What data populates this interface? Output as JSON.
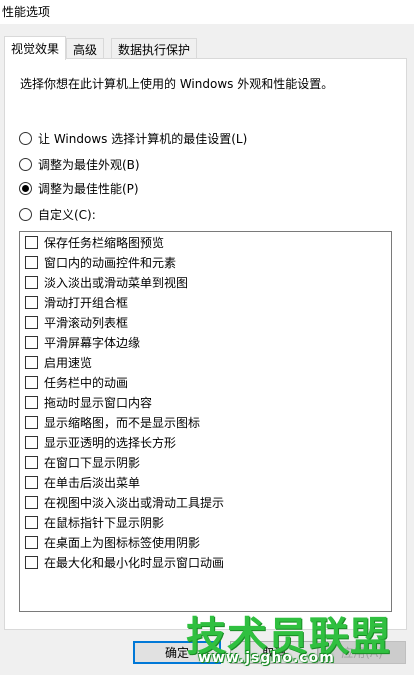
{
  "window": {
    "title": "性能选项"
  },
  "tabs": [
    {
      "label": "视觉效果",
      "active": true
    },
    {
      "label": "高级",
      "active": false
    },
    {
      "label": "数据执行保护",
      "active": false
    }
  ],
  "visual_effects": {
    "description": "选择你想在此计算机上使用的 Windows 外观和性能设置。",
    "options": [
      {
        "label": "让 Windows 选择计算机的最佳设置(L)",
        "checked": false
      },
      {
        "label": "调整为最佳外观(B)",
        "checked": false
      },
      {
        "label": "调整为最佳性能(P)",
        "checked": true
      },
      {
        "label": "自定义(C):",
        "checked": false
      }
    ],
    "effects": [
      "保存任务栏缩略图预览",
      "窗口内的动画控件和元素",
      "淡入淡出或滑动菜单到视图",
      "滑动打开组合框",
      "平滑滚动列表框",
      "平滑屏幕字体边缘",
      "启用速览",
      "任务栏中的动画",
      "拖动时显示窗口内容",
      "显示缩略图，而不是显示图标",
      "显示亚透明的选择长方形",
      "在窗口下显示阴影",
      "在单击后淡出菜单",
      "在视图中淡入淡出或滑动工具提示",
      "在鼠标指针下显示阴影",
      "在桌面上为图标标签使用阴影",
      "在最大化和最小化时显示窗口动画"
    ]
  },
  "buttons": {
    "ok": "确定",
    "cancel": "取消",
    "apply": "应用(A)"
  },
  "watermark": {
    "brand": "技术员联盟",
    "url": "www.jsgho.com",
    "color": "#30c040"
  }
}
